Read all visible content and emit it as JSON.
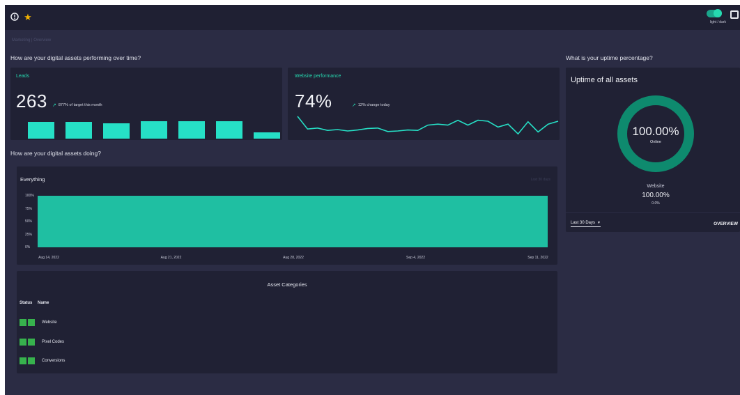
{
  "topbar": {
    "info_icon": "info-circle-icon",
    "star_icon": "star-icon",
    "theme_toggle_label": "light / dark",
    "chat_icon": "chat-icon"
  },
  "breadcrumb": "Marketing  |  Overview",
  "sections": {
    "performance_title": "How are your digital assets performing over time?",
    "doing_title": "How are your digital assets doing?",
    "uptime_title": "What is your uptime percentage?"
  },
  "leads": {
    "label": "Leads",
    "value": "263",
    "trend_text": "877% of target this month",
    "bars": [
      0.95,
      0.95,
      0.88,
      1.0,
      1.0,
      1.0,
      0.35
    ]
  },
  "website_performance": {
    "label": "Website performance",
    "value": "74%",
    "trend_text": "12% change today",
    "sparkline": [
      1.0,
      0.35,
      0.4,
      0.28,
      0.32,
      0.25,
      0.3,
      0.38,
      0.4,
      0.22,
      0.25,
      0.3,
      0.28,
      0.55,
      0.6,
      0.55,
      0.8,
      0.55,
      0.8,
      0.75,
      0.45,
      0.6,
      0.1,
      0.72,
      0.2,
      0.6,
      0.75
    ]
  },
  "everything_chart": {
    "title": "Everything",
    "last_updated": "Last 30 days",
    "chart_data": {
      "type": "area",
      "x": [
        "Aug 14, 2022",
        "Aug 21, 2022",
        "Aug 28, 2022",
        "Sep 4, 2022",
        "Sep 11, 2022"
      ],
      "y_ticks": [
        "100%",
        "75%",
        "50%",
        "25%",
        "0%"
      ],
      "ylim": [
        0,
        100
      ],
      "series": [
        {
          "values": [
            100,
            100,
            100,
            100,
            100
          ]
        }
      ],
      "color": "#1fbfa2"
    }
  },
  "asset_categories": {
    "title": "Asset Categories",
    "columns": [
      "Status",
      "Name"
    ],
    "rows": [
      {
        "name": "Website"
      },
      {
        "name": "Pixel Codes"
      },
      {
        "name": "Conversions"
      }
    ]
  },
  "uptime": {
    "title": "Uptime of all assets",
    "percent": "100.00%",
    "status": "Online",
    "legend_name": "Website",
    "legend_percent": "100.00%",
    "legend_sub": "0.0%",
    "range_label": "Last 30 Days",
    "overview_label": "OVERVIEW",
    "ring_fraction": 1.0
  },
  "colors": {
    "accent": "#26e0c6",
    "ring": "#0e8a6e",
    "status_green": "#37b24d"
  }
}
